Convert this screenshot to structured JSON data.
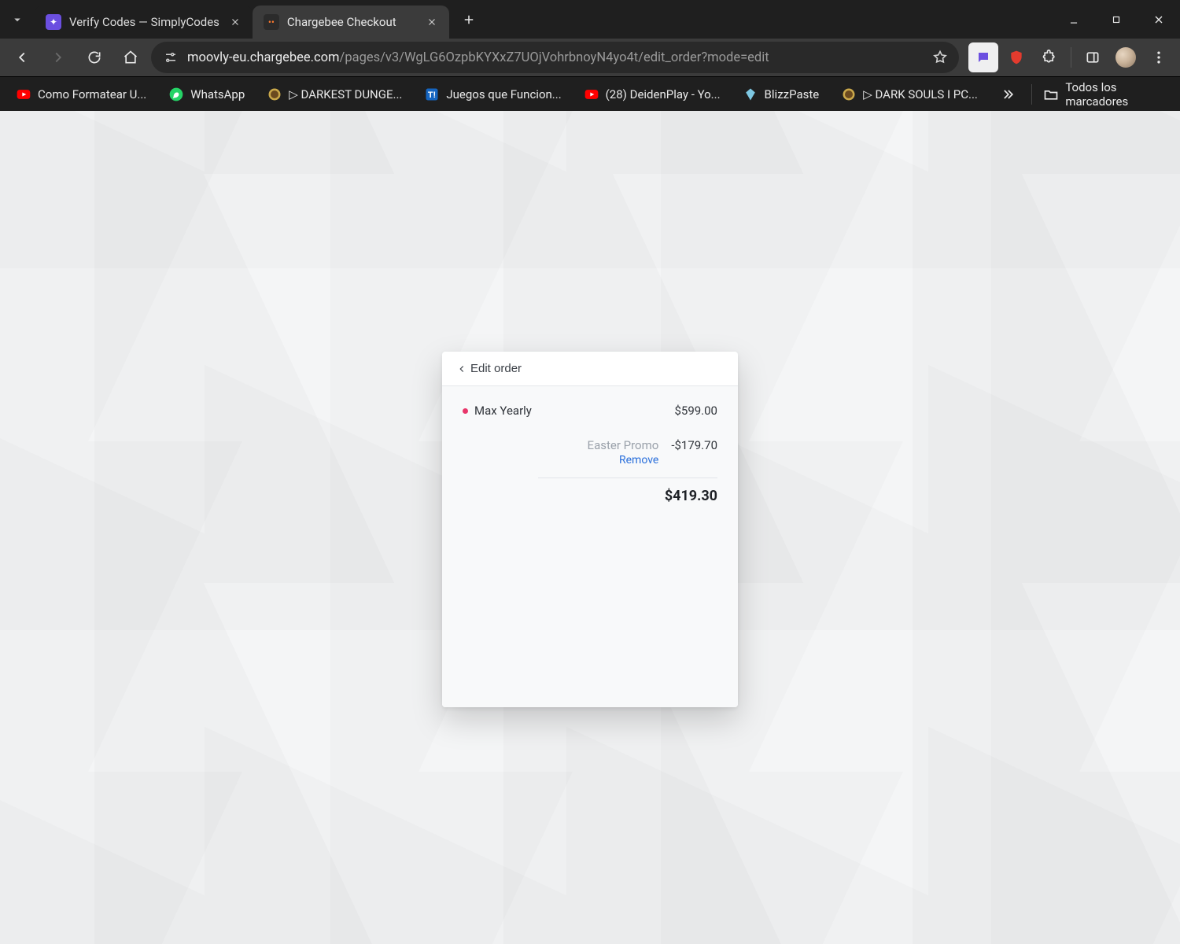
{
  "window": {
    "tabs": [
      {
        "title": "Verify Codes — SimplyCodes",
        "active": false,
        "favicon_bg": "#6b4fe0"
      },
      {
        "title": "Chargebee Checkout",
        "active": true,
        "favicon_bg": "#2b2b2b"
      }
    ]
  },
  "toolbar": {
    "url_host": "moovly-eu.chargebee.com",
    "url_path": "/pages/v3/WgLG6OzpbKYXxZ7UOjVohrbnoyN4yo4t/edit_order?mode=edit"
  },
  "bookmarks": {
    "items": [
      {
        "label": "Como Formatear U...",
        "icon": "youtube"
      },
      {
        "label": "WhatsApp",
        "icon": "whatsapp"
      },
      {
        "label": "▷ DARKEST DUNGE...",
        "icon": "coin"
      },
      {
        "label": "Juegos que Funcion...",
        "icon": "t-blue"
      },
      {
        "label": "(28) DeidenPlay - Yo...",
        "icon": "youtube"
      },
      {
        "label": "BlizzPaste",
        "icon": "diamond"
      },
      {
        "label": "▷ DARK SOULS I PC...",
        "icon": "coin"
      }
    ],
    "all_label": "Todos los marcadores"
  },
  "checkout": {
    "header_label": "Edit order",
    "item": {
      "name": "Max Yearly",
      "price": "$599.00"
    },
    "promo": {
      "label": "Easter Promo",
      "amount": "-$179.70",
      "remove_label": "Remove"
    },
    "total": "$419.30"
  }
}
